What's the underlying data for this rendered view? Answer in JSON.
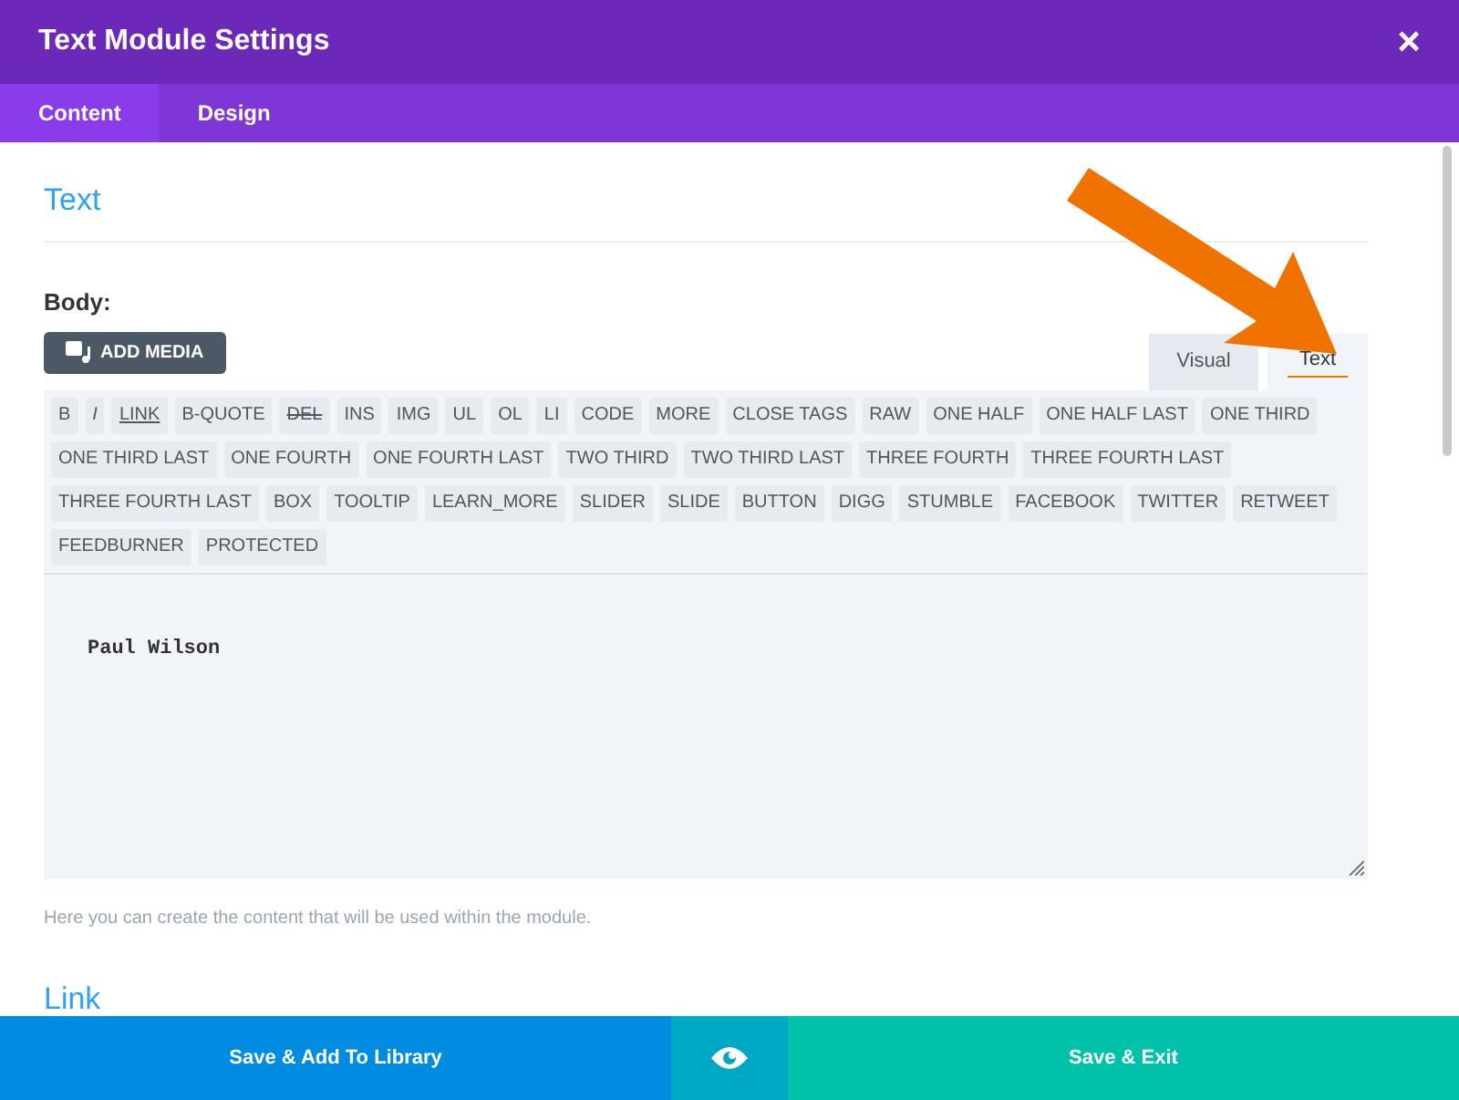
{
  "window": {
    "title": "Text Module Settings",
    "close": "×"
  },
  "tabs": [
    {
      "label": "Content",
      "selected": true
    },
    {
      "label": "Design",
      "selected": false
    }
  ],
  "section_title": "Text",
  "body_label": "Body:",
  "add_media": "ADD MEDIA",
  "editor_tabs": [
    {
      "label": "Visual",
      "selected": false
    },
    {
      "label": "Text",
      "selected": true
    }
  ],
  "quicktags": [
    {
      "label": "B",
      "kind": "plain"
    },
    {
      "label": "I",
      "kind": "italic"
    },
    {
      "label": "LINK",
      "kind": "link"
    },
    {
      "label": "B-QUOTE",
      "kind": "plain"
    },
    {
      "label": "DEL",
      "kind": "strike"
    },
    {
      "label": "INS",
      "kind": "plain"
    },
    {
      "label": "IMG",
      "kind": "plain"
    },
    {
      "label": "UL",
      "kind": "plain"
    },
    {
      "label": "OL",
      "kind": "plain"
    },
    {
      "label": "LI",
      "kind": "plain"
    },
    {
      "label": "CODE",
      "kind": "plain"
    },
    {
      "label": "MORE",
      "kind": "plain"
    },
    {
      "label": "CLOSE TAGS",
      "kind": "plain"
    },
    {
      "label": "RAW",
      "kind": "plain"
    },
    {
      "label": "ONE HALF",
      "kind": "plain"
    },
    {
      "label": "ONE HALF LAST",
      "kind": "plain"
    },
    {
      "label": "ONE THIRD",
      "kind": "plain"
    },
    {
      "label": "ONE THIRD LAST",
      "kind": "plain"
    },
    {
      "label": "ONE FOURTH",
      "kind": "plain"
    },
    {
      "label": "ONE FOURTH LAST",
      "kind": "plain"
    },
    {
      "label": "TWO THIRD",
      "kind": "plain"
    },
    {
      "label": "TWO THIRD LAST",
      "kind": "plain"
    },
    {
      "label": "THREE FOURTH",
      "kind": "plain"
    },
    {
      "label": "THREE FOURTH LAST",
      "kind": "plain"
    },
    {
      "label": "THREE FOURTH LAST",
      "kind": "plain"
    },
    {
      "label": "BOX",
      "kind": "plain"
    },
    {
      "label": "TOOLTIP",
      "kind": "plain"
    },
    {
      "label": "LEARN_MORE",
      "kind": "plain"
    },
    {
      "label": "SLIDER",
      "kind": "plain"
    },
    {
      "label": "SLIDE",
      "kind": "plain"
    },
    {
      "label": "BUTTON",
      "kind": "plain"
    },
    {
      "label": "DIGG",
      "kind": "plain"
    },
    {
      "label": "STUMBLE",
      "kind": "plain"
    },
    {
      "label": "FACEBOOK",
      "kind": "plain"
    },
    {
      "label": "TWITTER",
      "kind": "plain"
    },
    {
      "label": "RETWEET",
      "kind": "plain"
    },
    {
      "label": "FEEDBURNER",
      "kind": "plain"
    },
    {
      "label": "PROTECTED",
      "kind": "plain"
    }
  ],
  "editor_value": "Paul Wilson",
  "help_text": "Here you can create the content that will be used within the module.",
  "next_section_title": "Link",
  "footer": {
    "save_library": "Save & Add To Library",
    "save_exit": "Save & Exit"
  }
}
